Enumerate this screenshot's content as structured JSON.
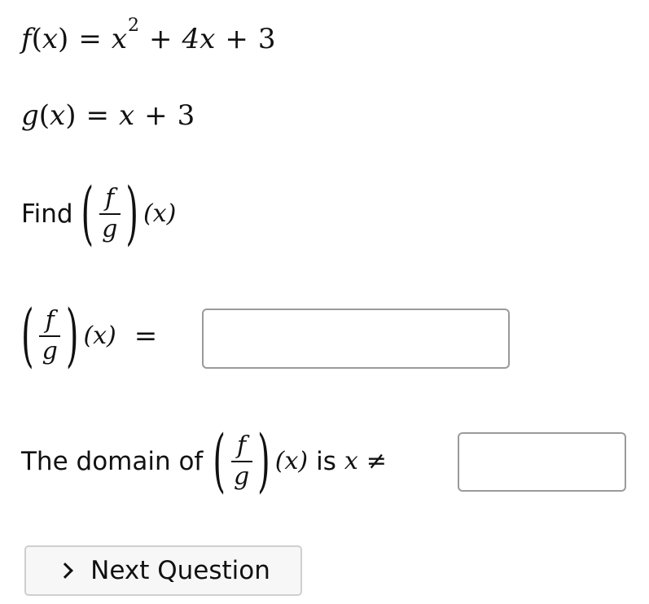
{
  "equations": {
    "f_def": {
      "lhs_func": "f",
      "lhs_var": "x",
      "rhs_term1_var": "x",
      "rhs_term1_exp": "2",
      "rhs_plus1": "+",
      "rhs_term2": "4x",
      "rhs_plus2": "+",
      "rhs_term3": "3"
    },
    "g_def": {
      "lhs_func": "g",
      "lhs_var": "x",
      "rhs_var": "x",
      "rhs_plus": "+",
      "rhs_const": "3"
    }
  },
  "prompt": {
    "find_label": "Find",
    "frac_num": "f",
    "frac_den": "g",
    "arg": "(x)"
  },
  "answer_row": {
    "frac_num": "f",
    "frac_den": "g",
    "arg": "(x)",
    "equals": "=",
    "input_value": "",
    "input_placeholder": ""
  },
  "domain_row": {
    "prefix": "The domain of",
    "frac_num": "f",
    "frac_den": "g",
    "arg": "(x)",
    "is_text": "is",
    "var": "x",
    "neq": "≠",
    "input_value": "",
    "input_placeholder": ""
  },
  "next_button": {
    "label": "Next Question",
    "icon": "chevron-right-icon"
  }
}
